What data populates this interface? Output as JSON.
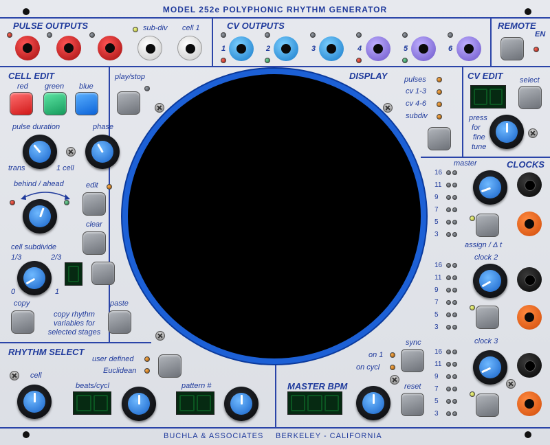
{
  "title": "MODEL 252e POLYPHONIC RHYTHM GENERATOR",
  "footer": {
    "left": "BUCHLA & ASSOCIATES",
    "right": "BERKELEY - CALIFORNIA"
  },
  "pulse_outputs": {
    "header": "PULSE OUTPUTS",
    "subdiv": "sub-div",
    "cell1": "cell 1"
  },
  "cv_outputs": {
    "header": "CV OUTPUTS",
    "nums": [
      "1",
      "2",
      "3",
      "4",
      "5",
      "6"
    ]
  },
  "remote": {
    "header": "REMOTE",
    "en": "EN"
  },
  "cell_edit": {
    "header": "CELL EDIT",
    "red": "red",
    "green": "green",
    "blue": "blue",
    "pulse_duration": "pulse duration",
    "phase": "phase",
    "trans": "trans",
    "one_cell": "1 cell",
    "behind_ahead": "behind / ahead",
    "edit": "edit",
    "clear": "clear",
    "cell_subdivide": "cell subdivide",
    "third1": "1/3",
    "third2": "2/3",
    "zero": "0",
    "one": "1",
    "copy": "copy",
    "paste": "paste",
    "copy_desc_1": "copy rhythm",
    "copy_desc_2": "variables for",
    "copy_desc_3": "selected stages"
  },
  "play": {
    "label": "play/stop"
  },
  "display": {
    "header": "DISPLAY",
    "pulses": "pulses",
    "cv13": "cv 1-3",
    "cv46": "cv 4-6",
    "subdiv": "subdiv"
  },
  "cv_edit": {
    "header": "CV EDIT",
    "select": "select",
    "press1": "press",
    "press2": "for",
    "press3": "fine",
    "press4": "tune"
  },
  "clocks": {
    "header": "CLOCKS",
    "master": "master",
    "assign": "assign / Δ t",
    "clock2": "clock 2",
    "clock3": "clock 3",
    "ratios": [
      "16",
      "11",
      "9",
      "7",
      "5",
      "3"
    ]
  },
  "rhythm_select": {
    "header": "RHYTHM SELECT",
    "cell": "cell",
    "user_defined": "user defined",
    "euclidean": "Euclidean",
    "beats": "beats/cycl",
    "pattern": "pattern #"
  },
  "master_bpm": {
    "header": "MASTER BPM",
    "on1": "on 1",
    "oncycl": "on cycl",
    "sync": "sync",
    "reset": "reset"
  },
  "colors": {
    "accent": "#1f3a9c",
    "display_ring": "#1c60d6"
  }
}
